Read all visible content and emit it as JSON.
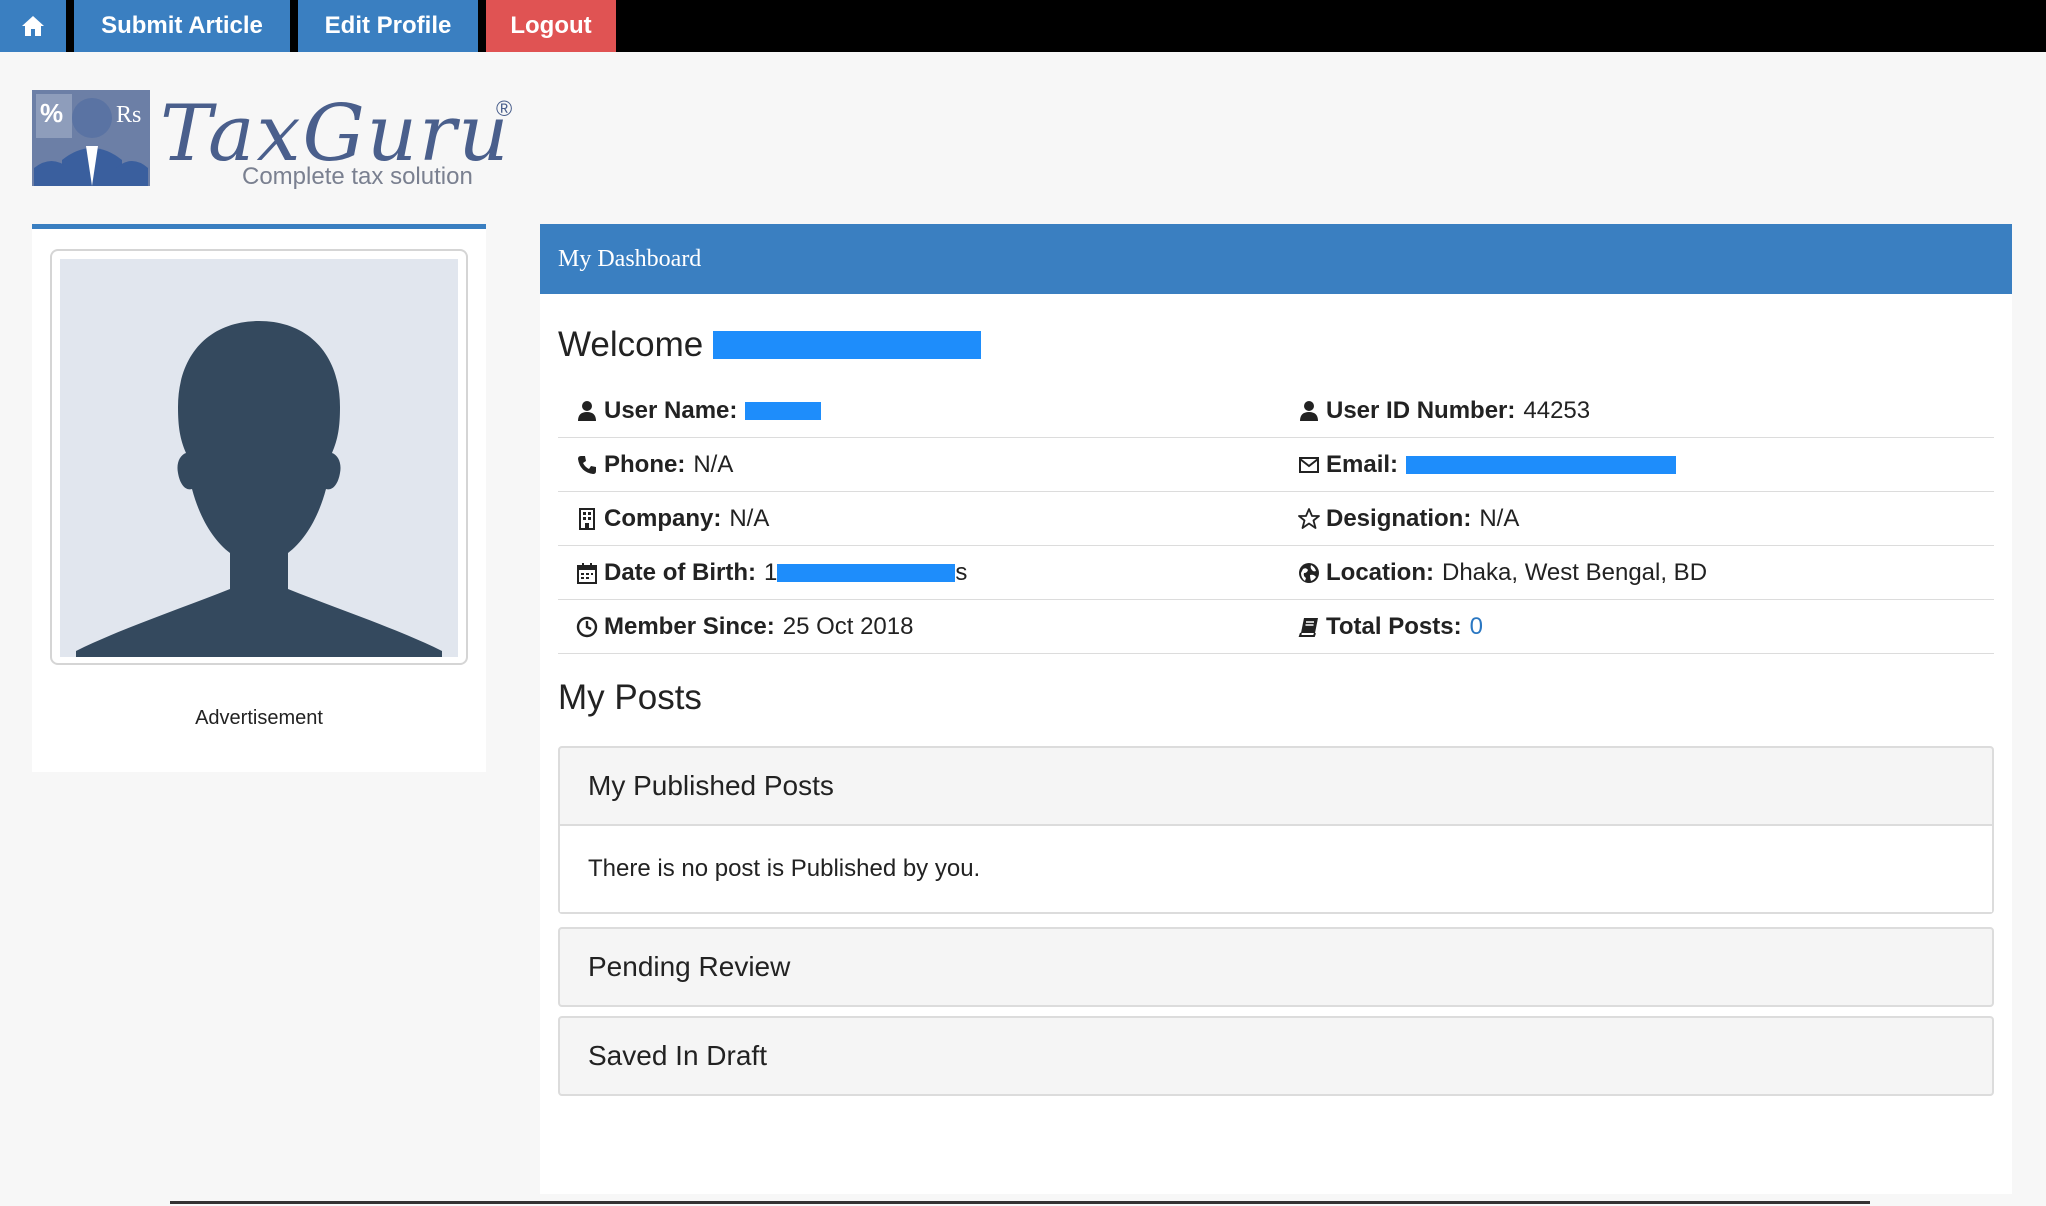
{
  "nav": {
    "home_icon": "home-icon",
    "submit_label": "Submit Article",
    "edit_label": "Edit Profile",
    "logout_label": "Logout"
  },
  "logo": {
    "brand": "TaxGuru",
    "registered": "®",
    "tagline": "Complete tax solution",
    "badge_symbols": "% Rs"
  },
  "sidebar": {
    "avatar_icon": "user-silhouette-icon",
    "ad_label": "Advertisement"
  },
  "dashboard": {
    "header": "My Dashboard",
    "welcome_label": "Welcome",
    "info": {
      "username_label": "User Name:",
      "userid_label": "User ID Number:",
      "userid_value": "44253",
      "phone_label": "Phone:",
      "phone_value": "N/A",
      "email_label": "Email:",
      "company_label": "Company:",
      "company_value": "N/A",
      "designation_label": "Designation:",
      "designation_value": "N/A",
      "dob_label": "Date of Birth:",
      "dob_prefix": "1",
      "dob_suffix": "s",
      "location_label": "Location:",
      "location_value": "Dhaka, West Bengal, BD",
      "member_label": "Member Since:",
      "member_value": "25 Oct 2018",
      "posts_label": "Total Posts:",
      "posts_value": "0"
    },
    "posts_title": "My Posts",
    "published_title": "My Published Posts",
    "published_empty": "There is no post is Published by you.",
    "pending_title": "Pending Review",
    "draft_title": "Saved In Draft"
  },
  "colors": {
    "accent": "#3a7fc1",
    "logout": "#e05353",
    "redaction": "#1e8dfb",
    "link": "#2a77c2"
  }
}
